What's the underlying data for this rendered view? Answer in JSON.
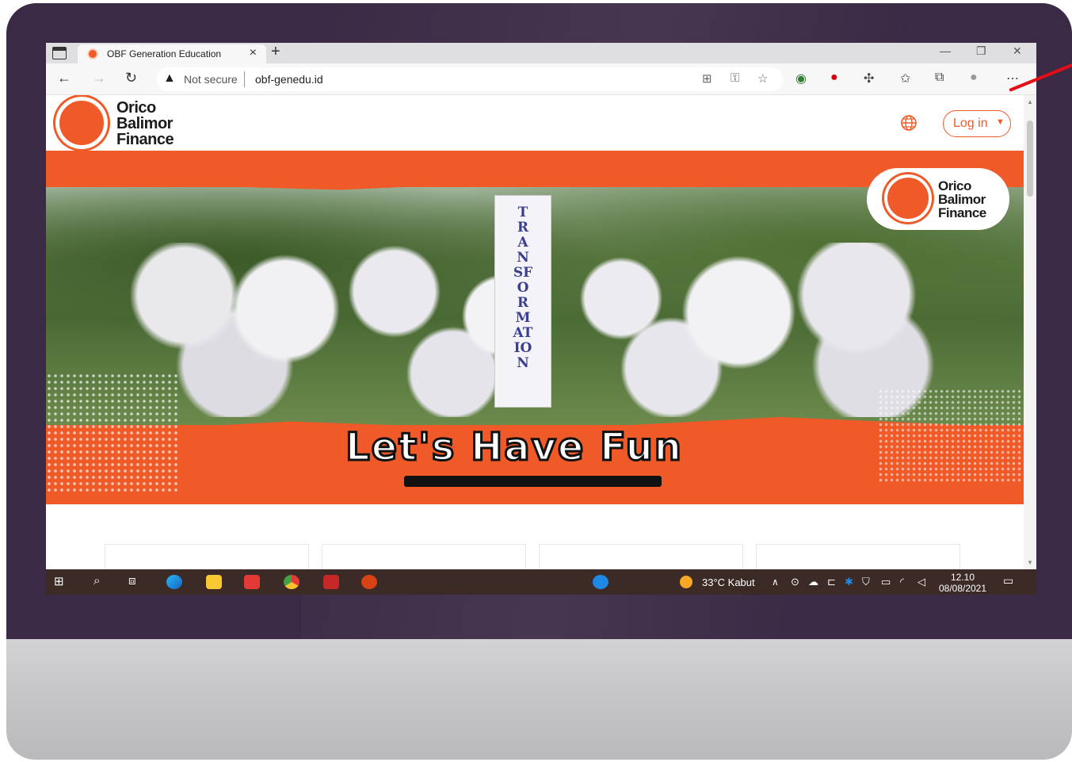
{
  "browser": {
    "tab_title": "OBF Generation Education",
    "tab_close": "×",
    "new_tab": "+",
    "not_secure": "Not secure",
    "url": "obf-genedu.id"
  },
  "header": {
    "logo_text": "Orico\nBalimor\nFinance",
    "login_label": "Log in"
  },
  "banner": {
    "vertical_banner_text": "TRANSFORMATION",
    "logo_text": "Orico\nBalimor\nFinance",
    "headline": "Let's Have Fun"
  },
  "taskbar": {
    "weather": "33°C  Kabut",
    "time": "12.10",
    "date": "08/08/2021"
  },
  "colors": {
    "brand": "#f05a28",
    "bezel": "#3b2a45",
    "pointer": "#e30e16"
  }
}
